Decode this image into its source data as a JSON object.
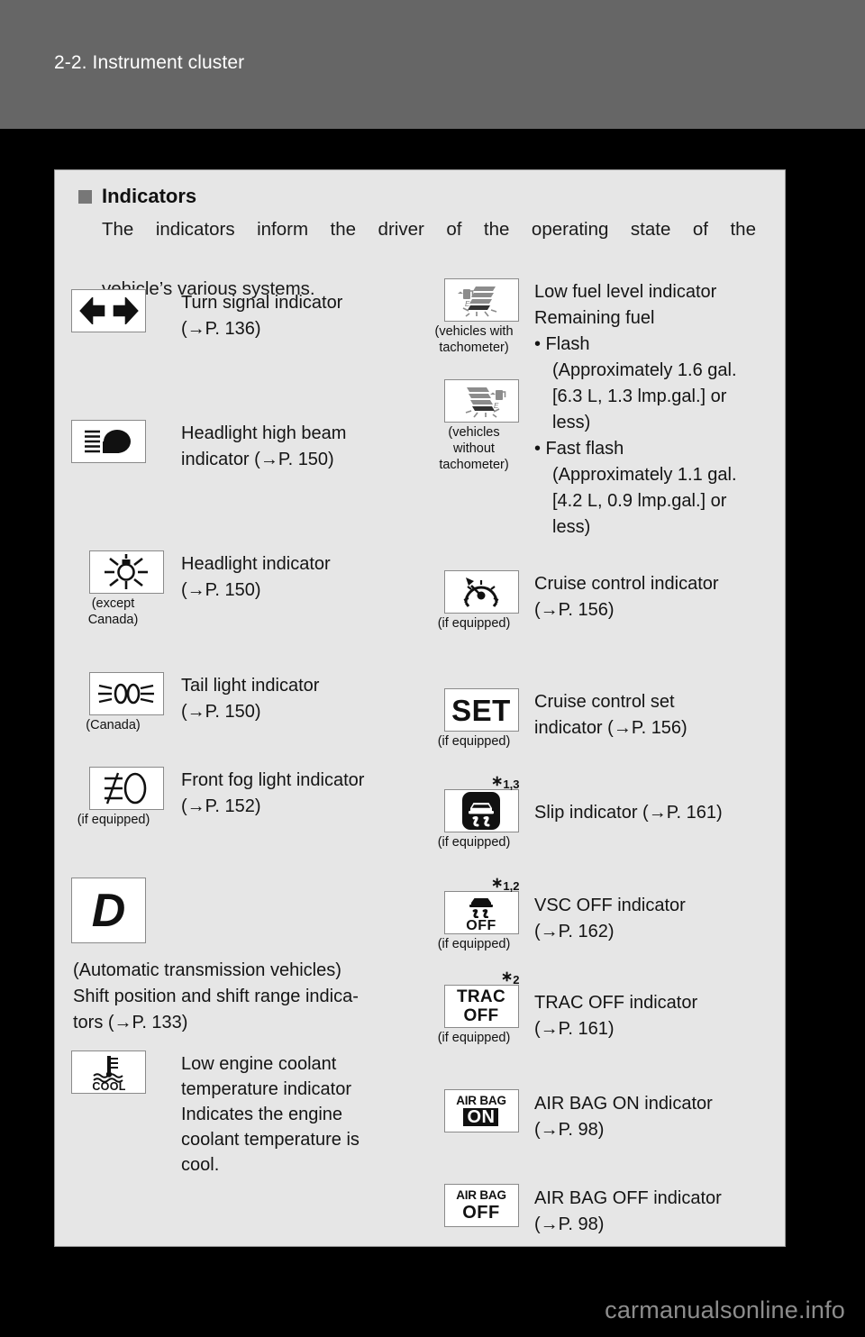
{
  "header": {
    "title": "2-2. Instrument cluster"
  },
  "intro": {
    "bullet_icon": "square-bullet-icon",
    "title": "Indicators",
    "line1": "The indicators inform the driver of the operating state of the",
    "line2": "vehicle’s various systems."
  },
  "left_column": [
    {
      "icon": "turn-signal-icon",
      "sub": "",
      "desc_line1": "Turn signal indicator",
      "desc_line2": "(→P. 136)"
    },
    {
      "icon": "headlight-high-beam-icon",
      "sub": "",
      "desc_line1": "Headlight high beam",
      "desc_line2": "indicator (→P. 150)"
    },
    {
      "icon": "headlight-icon",
      "sub": "(except\nCanada)",
      "sub_l1": "(except",
      "sub_l2": "Canada)",
      "desc_line1": "Headlight indicator",
      "desc_line2": "(→P. 150)"
    },
    {
      "icon": "tail-light-icon",
      "sub_l1": "(Canada)",
      "sub_l2": "",
      "desc_line1": "Tail light indicator",
      "desc_line2": "(→P. 150)"
    },
    {
      "icon": "front-fog-light-icon",
      "sub_l1": "(if equipped)",
      "sub_l2": "",
      "desc_line1": "Front fog light indicator",
      "desc_line2": "(→P. 152)"
    },
    {
      "icon": "shift-position-d-icon",
      "sub_l1": "",
      "sub_l2": "",
      "desc_line1": "",
      "desc_line2": ""
    },
    {
      "icon": "low-engine-coolant-temperature-icon",
      "sub_l1": "",
      "sub_l2": "",
      "desc_line1": "Low engine coolant",
      "desc_line2": "temperature indicator",
      "desc_line3": "Indicates the engine",
      "desc_line4": "coolant temperature is",
      "desc_line5": "cool."
    }
  ],
  "shift_paragraph": {
    "line1": " (Automatic transmission vehicles)",
    "line2": "Shift position and shift range indica-",
    "line3": "tors (→P. 133)"
  },
  "right_column": [
    {
      "icon": "low-fuel-level-with-tachometer-icon",
      "sub_l1": "(vehicles with",
      "sub_l2": "tachometer)",
      "footnote": ""
    },
    {
      "icon": "low-fuel-level-without-tachometer-icon",
      "sub_l1": "(vehicles",
      "sub_l2": "without",
      "sub_l3": "tachometer)",
      "footnote": ""
    },
    {
      "icon": "cruise-control-icon",
      "sub_l1": "(if equipped)",
      "footnote": "",
      "desc_line1": "Cruise control indicator",
      "desc_line2": "(→P. 156)"
    },
    {
      "icon": "cruise-control-set-icon",
      "icon_text": "SET",
      "sub_l1": "(if equipped)",
      "footnote": "",
      "desc_line1": "Cruise control set",
      "desc_line2": "indicator (→P. 156)"
    },
    {
      "icon": "slip-indicator-icon",
      "sub_l1": "(if equipped)",
      "footnote_star": "∗",
      "footnote_num": "1,3",
      "desc_line1": "Slip indicator (→P. 161)",
      "desc_line2": ""
    },
    {
      "icon": "vsc-off-icon",
      "icon_text": "OFF",
      "sub_l1": "(if equipped)",
      "footnote_star": "∗",
      "footnote_num": "1,2",
      "desc_line1": "VSC OFF indicator",
      "desc_line2": "(→P. 162)"
    },
    {
      "icon": "trac-off-icon",
      "icon_text_1": "TRAC",
      "icon_text_2": "OFF",
      "sub_l1": "(if equipped)",
      "footnote_star": "∗",
      "footnote_num": "2",
      "desc_line1": "TRAC OFF indicator",
      "desc_line2": "(→P. 161)"
    },
    {
      "icon": "air-bag-on-icon",
      "icon_text_1": "AIR BAG",
      "icon_text_2": "ON",
      "sub_l1": "",
      "desc_line1": "AIR BAG ON indicator",
      "desc_line2": "(→P. 98)"
    },
    {
      "icon": "air-bag-off-icon",
      "icon_text_1": "AIR BAG",
      "icon_text_2": "OFF",
      "sub_l1": "",
      "desc_line1": "AIR BAG OFF indicator",
      "desc_line2": "(→P. 98)"
    }
  ],
  "fuel_text": {
    "line1": "Low fuel level indicator",
    "line2": "Remaining fuel",
    "line3": "• Flash",
    "line4": "(Approximately 1.6 gal.",
    "line5": "[6.3 L, 1.3 lmp.gal.] or",
    "line6": "less)",
    "line7": "• Fast flash",
    "line8": "(Approximately 1.1 gal.",
    "line9": "[4.2 L, 0.9 lmp.gal.] or",
    "line10": "less)"
  },
  "watermark": {
    "text": "carmanualsonline.info"
  },
  "colors": {
    "header_bar": "#666666",
    "panel_bg": "#e6e6e6",
    "page_bg": "#000000",
    "icon_box_bg": "#ffffff",
    "text": "#141414",
    "gray_icon": "#8c8c8c",
    "watermark": "#8d8d8d"
  }
}
